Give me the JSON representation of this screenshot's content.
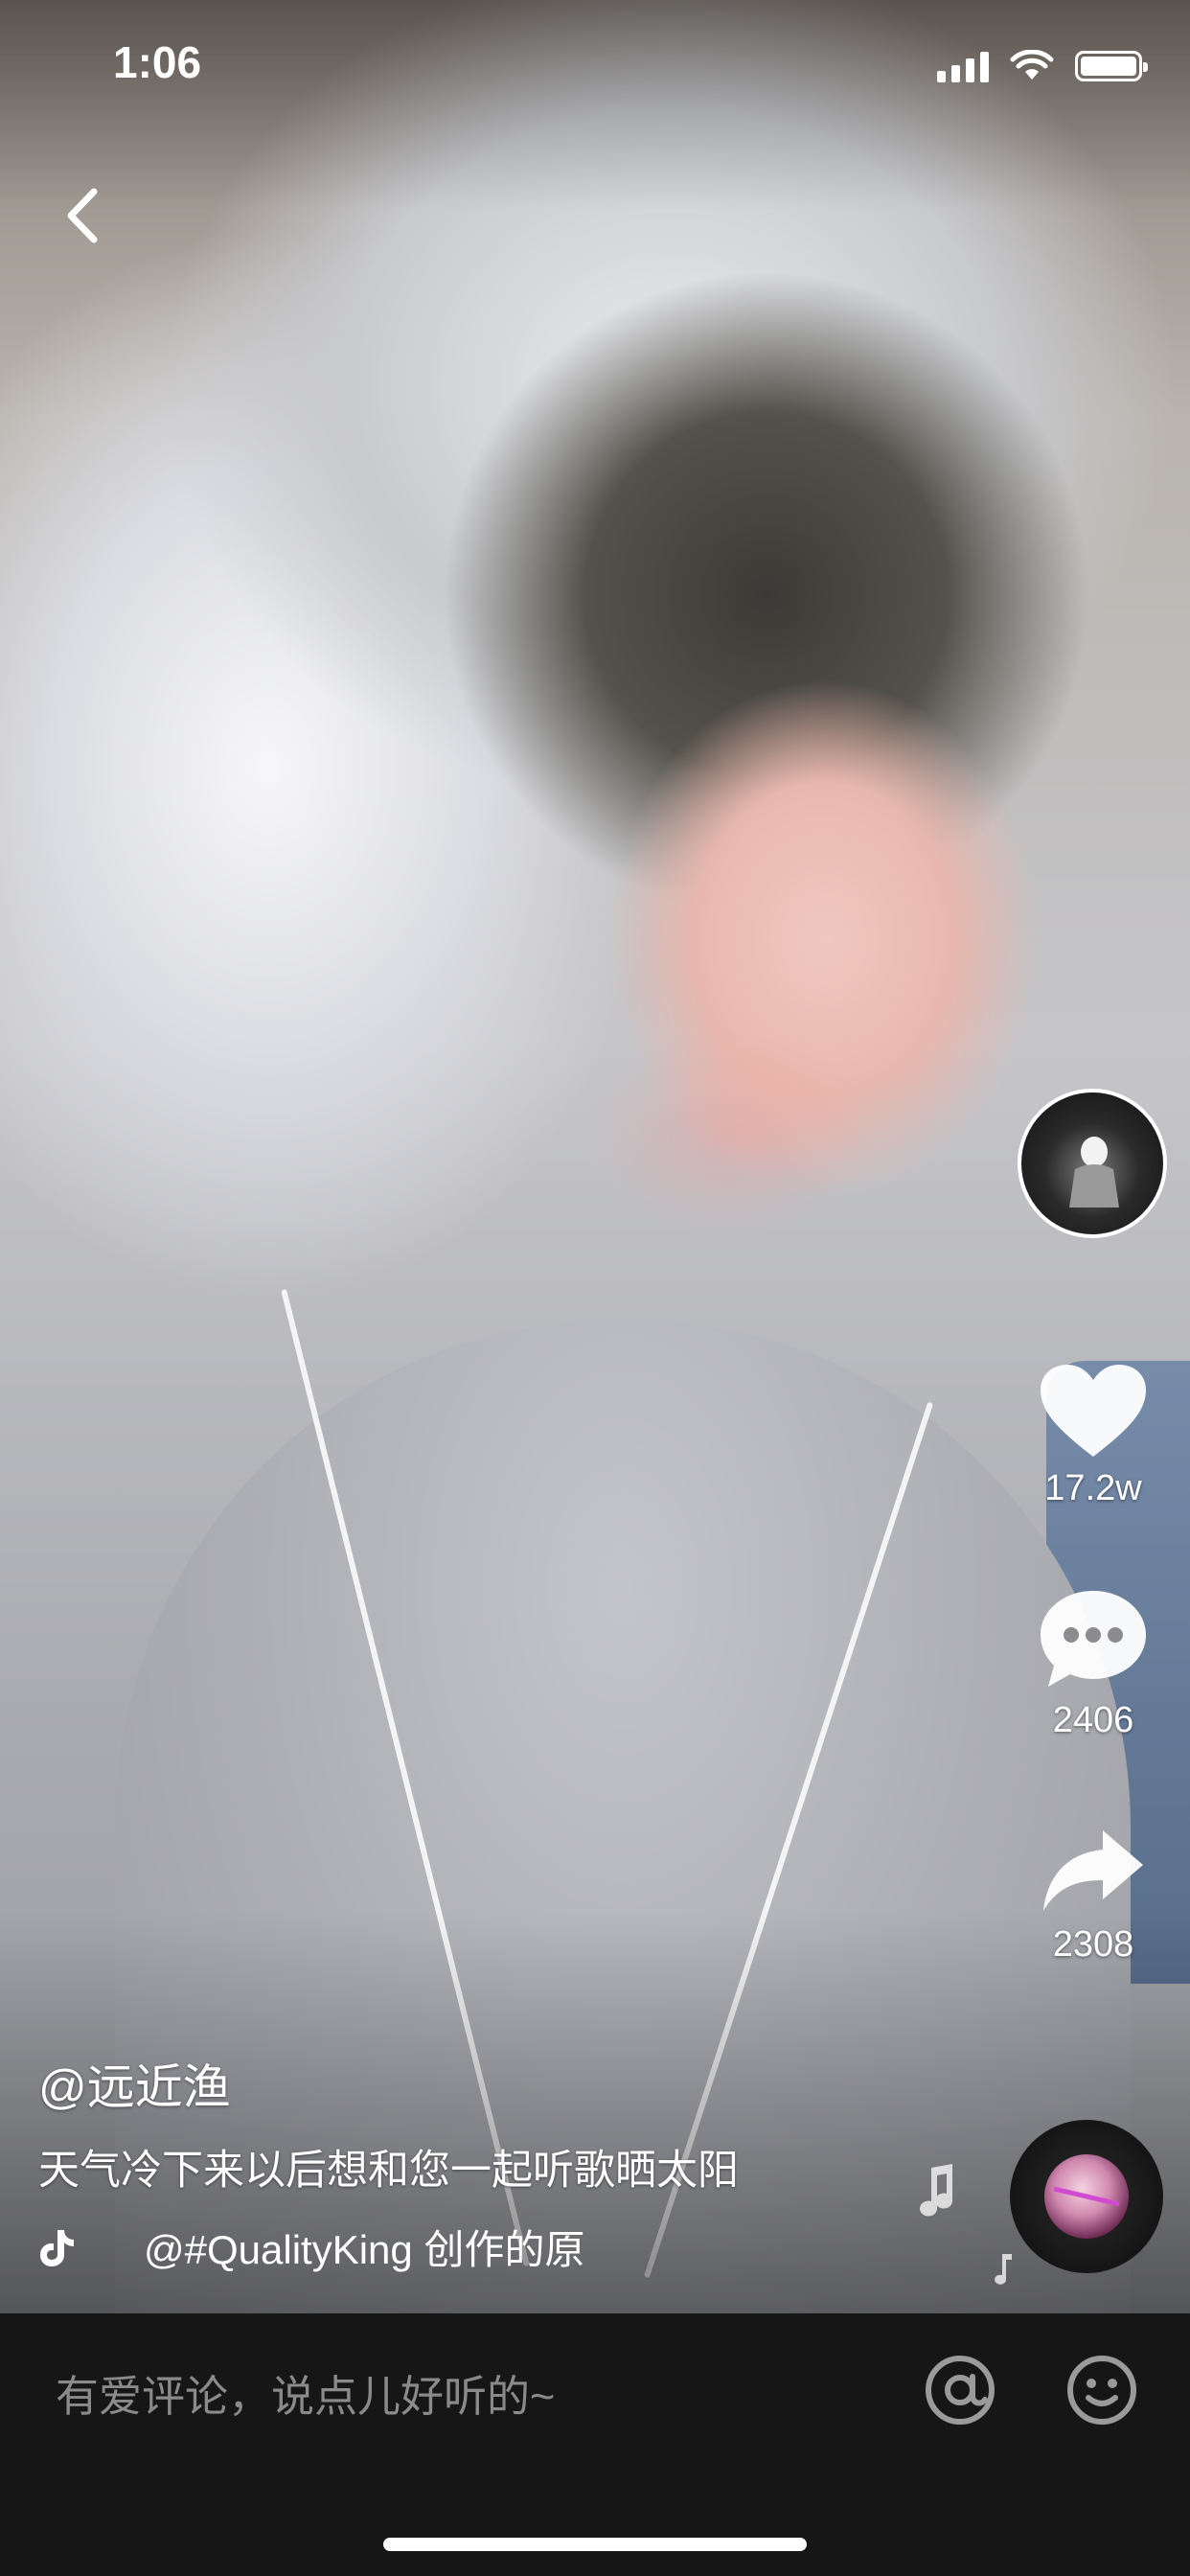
{
  "status_bar": {
    "time": "1:06",
    "icons": [
      "cellular-signal-icon",
      "wifi-icon",
      "battery-icon"
    ]
  },
  "top": {
    "back_icon": "chevron-left-icon"
  },
  "right_rail": {
    "avatar_icon": "creator-avatar",
    "like": {
      "icon": "heart-icon",
      "count": "17.2w"
    },
    "comment": {
      "icon": "comment-bubble-icon",
      "count": "2406"
    },
    "share": {
      "icon": "share-arrow-icon",
      "count": "2308"
    }
  },
  "post": {
    "author": "@远近渔",
    "caption": "天气冷下来以后想和您一起听歌晒太阳",
    "music": "@#QualityKing 创作的原"
  },
  "comment_bar": {
    "placeholder": "有爱评论，说点儿好听的~",
    "mention_icon": "at-sign-icon",
    "emoji_icon": "emoji-face-icon"
  },
  "colors": {
    "text": "#ffffff",
    "comment_bar_bg": "#161616",
    "placeholder": "#8a8a8a"
  }
}
